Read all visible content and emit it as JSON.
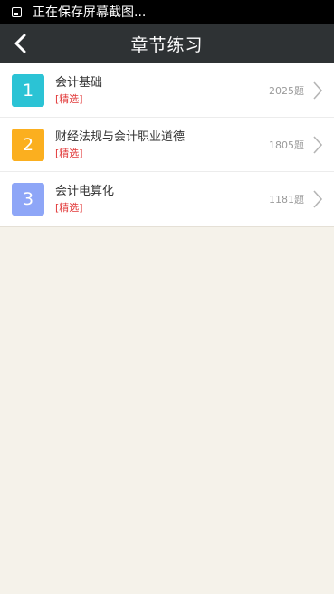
{
  "status_bar": {
    "text": "正在保存屏幕截图..."
  },
  "header": {
    "title": "章节练习"
  },
  "chapters": [
    {
      "num": "1",
      "name": "会计基础",
      "tag": "[精选]",
      "count": "2025题",
      "color": "#2bc3d5"
    },
    {
      "num": "2",
      "name": "财经法规与会计职业道德",
      "tag": "[精选]",
      "count": "1805题",
      "color": "#fbaf1f"
    },
    {
      "num": "3",
      "name": "会计电算化",
      "tag": "[精选]",
      "count": "1181题",
      "color": "#8ea6f7"
    }
  ]
}
